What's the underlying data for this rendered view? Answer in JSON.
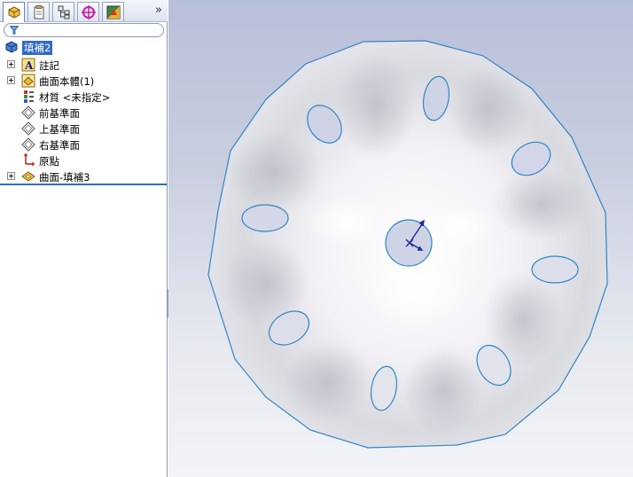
{
  "tabs": [
    {
      "name": "featuremanager-tab-icon"
    },
    {
      "name": "propertymanager-tab-icon"
    },
    {
      "name": "configurationmanager-tab-icon"
    },
    {
      "name": "dimxpert-tab-icon"
    },
    {
      "name": "display-manager-tab-icon"
    }
  ],
  "more_tabs": "»",
  "tree": {
    "root": "填補2",
    "items": [
      {
        "label": "註記",
        "icon": "annotations-icon",
        "expandable": true
      },
      {
        "label": "曲面本體(1)",
        "icon": "surface-bodies-icon",
        "expandable": true
      },
      {
        "label": "材質 <未指定>",
        "icon": "material-icon",
        "expandable": false
      },
      {
        "label": "前基準面",
        "icon": "plane-icon",
        "expandable": false
      },
      {
        "label": "上基準面",
        "icon": "plane-icon",
        "expandable": false
      },
      {
        "label": "右基準面",
        "icon": "plane-icon",
        "expandable": false
      },
      {
        "label": "原點",
        "icon": "origin-icon",
        "expandable": false
      },
      {
        "label": "曲面-填補3",
        "icon": "surface-fill-icon",
        "expandable": true
      }
    ]
  },
  "colors": {
    "accent": "#316ac5",
    "edge": "#2f86c6",
    "triad": "#1a2f9a"
  }
}
